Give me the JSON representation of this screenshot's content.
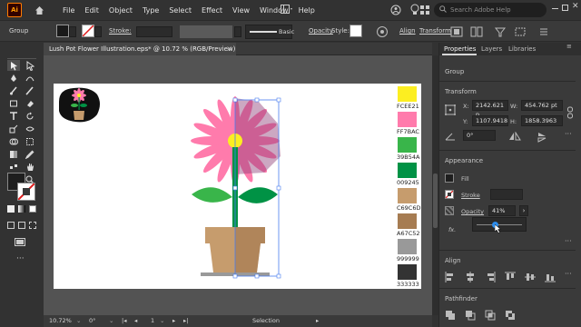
{
  "app": {
    "logo": "Ai",
    "menu": [
      "File",
      "Edit",
      "Object",
      "Type",
      "Select",
      "Effect",
      "View",
      "Window",
      "Help"
    ],
    "search_placeholder": "Search Adobe Help"
  },
  "control_bar": {
    "selection_label": "Group",
    "stroke_label": "Stroke:",
    "brush_label": "Basic",
    "opacity_label": "Opacity",
    "style_label": "Style:",
    "align_label": "Align",
    "transform_label": "Transform"
  },
  "document": {
    "tab_title": "Lush Pot Flower Illustration.eps* @ 10.72 % (RGB/Preview)",
    "close": "×"
  },
  "swatches": [
    {
      "hex": "FCEE21",
      "color": "#FCEE21"
    },
    {
      "hex": "FF7BAC",
      "color": "#FF7BAC"
    },
    {
      "hex": "39B54A",
      "color": "#39B54A"
    },
    {
      "hex": "009245",
      "color": "#009245"
    },
    {
      "hex": "C69C6D",
      "color": "#C69C6D"
    },
    {
      "hex": "A67C52",
      "color": "#A67C52"
    },
    {
      "hex": "999999",
      "color": "#999999"
    },
    {
      "hex": "333333",
      "color": "#333333"
    }
  ],
  "status_bar": {
    "zoom": "10.72%",
    "rotation": "0°",
    "artboard_number": "1",
    "tool": "Selection"
  },
  "panel": {
    "tabs": [
      "Properties",
      "Layers",
      "Libraries"
    ],
    "selection_type": "Group",
    "transform_heading": "Transform",
    "x_label": "X:",
    "x_value": "2142.621 p",
    "y_label": "Y:",
    "y_value": "1107.9418",
    "w_label": "W:",
    "w_value": "454.762 pt",
    "h_label": "H:",
    "h_value": "1858.3963",
    "angle_value": "0°",
    "appearance_heading": "Appearance",
    "fill_label": "Fill",
    "stroke_label": "Stroke",
    "opacity_label": "Opacity",
    "opacity_value": "41%",
    "opacity_fraction": 0.41,
    "fx_label": "fx.",
    "align_heading": "Align",
    "pathfinder_heading": "Pathfinder"
  },
  "colors": {
    "accent": "#2d8ceb",
    "selection": "#4a7df0"
  }
}
